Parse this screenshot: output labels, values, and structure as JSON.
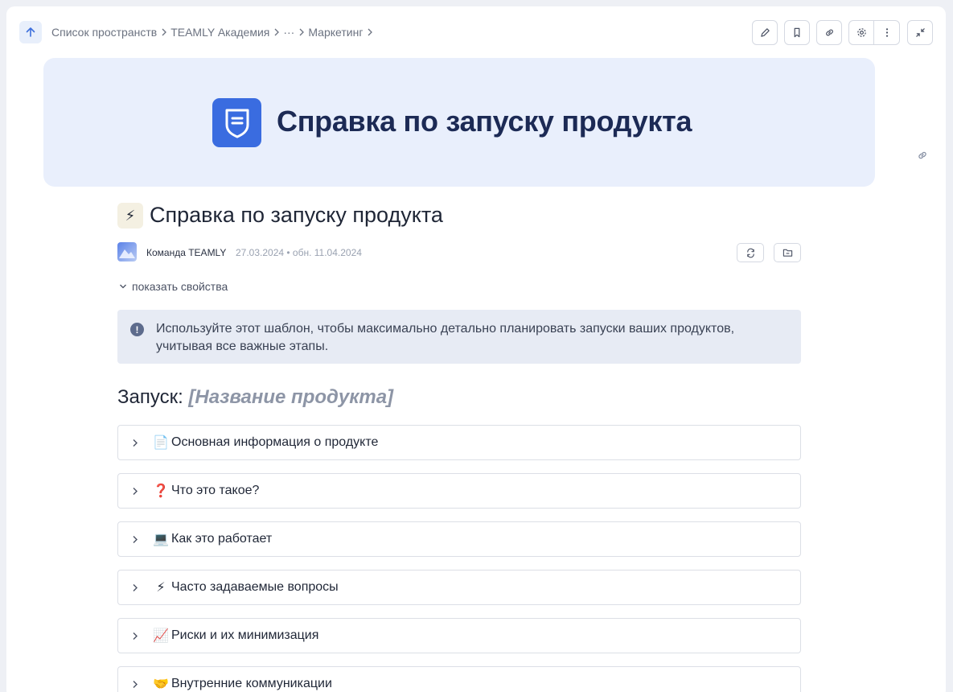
{
  "breadcrumb": [
    "Список пространств",
    "TEAMLY Академия",
    "···",
    "Маркетинг"
  ],
  "toolbar": {
    "icons": [
      "pencil-icon",
      "bookmark-icon",
      "link-icon",
      "gear-icon",
      "more-vertical-icon",
      "collapse-icon"
    ]
  },
  "cover": {
    "title": "Справка по запуску продукта",
    "accent": "#3a6ce0",
    "background": "#e9effc"
  },
  "page": {
    "emoji": "⚡",
    "title": "Справка по запуску продукта",
    "author": "Команда TEAMLY",
    "dates": "27.03.2024 • обн. 11.04.2024",
    "show_properties": "показать свойства"
  },
  "callout": {
    "text": "Используйте этот шаблон, чтобы максимально детально планировать запуски ваших продуктов, учитывая все важные этапы."
  },
  "section": {
    "title_prefix": "Запуск:",
    "title_placeholder": "[Название продукта]"
  },
  "toggles": [
    {
      "emoji": "📄",
      "label": "Основная информация о продукте"
    },
    {
      "emoji": "❓",
      "label": "Что это такое?"
    },
    {
      "emoji": "💻",
      "label": "Как это работает"
    },
    {
      "emoji": "⚡",
      "label": "Часто задаваемые вопросы"
    },
    {
      "emoji": "📈",
      "label": "Риски и их минимизация"
    },
    {
      "emoji": "🤝",
      "label": "Внутренние коммуникации"
    }
  ]
}
